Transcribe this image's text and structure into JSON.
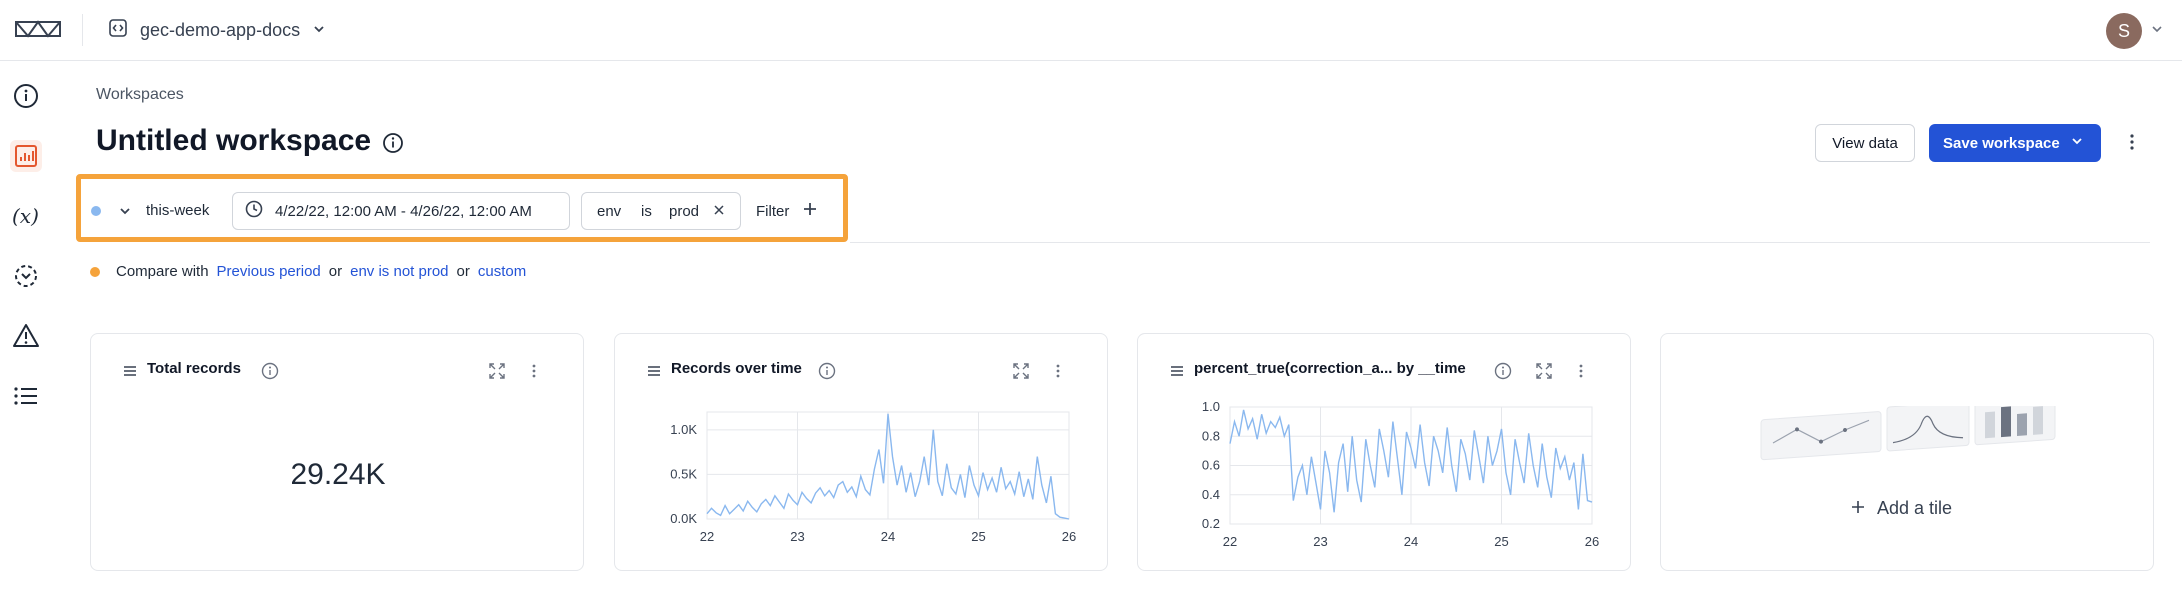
{
  "header": {
    "project_name": "gec-demo-app-docs",
    "avatar_initial": "S"
  },
  "page": {
    "breadcrumb": "Workspaces",
    "title": "Untitled workspace",
    "view_data_label": "View data",
    "save_label": "Save workspace"
  },
  "filters": {
    "segment_name": "this-week",
    "date_range": "4/22/22, 12:00 AM - 4/26/22, 12:00 AM",
    "condition": {
      "field": "env",
      "operator": "is",
      "value": "prod"
    },
    "filter_label": "Filter"
  },
  "compare": {
    "prefix": "Compare with",
    "option_previous": "Previous period",
    "sep1": "or",
    "option_env": "env is not prod",
    "sep2": "or",
    "option_custom": "custom"
  },
  "tiles": {
    "total": {
      "title": "Total records",
      "value": "29.24K"
    },
    "records_over_time": {
      "title": "Records over time"
    },
    "percent_true": {
      "title": "percent_true(correction_a... by __time"
    },
    "add_tile_label": "Add a tile"
  },
  "chart_data": [
    {
      "type": "line",
      "title": "Records over time",
      "x_tick_labels": [
        "22",
        "23",
        "24",
        "25",
        "26"
      ],
      "y_tick_labels": [
        "0.0K",
        "0.5K",
        "1.0K"
      ],
      "xlim": [
        22,
        26
      ],
      "ylim": [
        0,
        1200
      ],
      "x": [
        22.0,
        22.05,
        22.1,
        22.15,
        22.2,
        22.25,
        22.3,
        22.35,
        22.4,
        22.45,
        22.5,
        22.55,
        22.6,
        22.65,
        22.7,
        22.75,
        22.8,
        22.85,
        22.9,
        22.95,
        23.0,
        23.05,
        23.1,
        23.15,
        23.2,
        23.25,
        23.3,
        23.35,
        23.4,
        23.45,
        23.5,
        23.55,
        23.6,
        23.65,
        23.7,
        23.75,
        23.8,
        23.85,
        23.9,
        23.95,
        24.0,
        24.05,
        24.1,
        24.15,
        24.2,
        24.25,
        24.3,
        24.35,
        24.4,
        24.45,
        24.5,
        24.55,
        24.6,
        24.65,
        24.7,
        24.75,
        24.8,
        24.85,
        24.9,
        24.95,
        25.0,
        25.05,
        25.1,
        25.15,
        25.2,
        25.25,
        25.3,
        25.35,
        25.4,
        25.45,
        25.5,
        25.55,
        25.6,
        25.65,
        25.7,
        25.75,
        25.8,
        25.85,
        25.9,
        25.95,
        26.0
      ],
      "series": [
        {
          "values": [
            60,
            120,
            70,
            40,
            150,
            60,
            110,
            160,
            90,
            200,
            130,
            80,
            170,
            220,
            150,
            260,
            190,
            120,
            280,
            210,
            160,
            300,
            230,
            180,
            290,
            350,
            260,
            320,
            240,
            380,
            420,
            300,
            360,
            250,
            480,
            330,
            270,
            560,
            780,
            400,
            1180,
            700,
            380,
            600,
            300,
            520,
            250,
            420,
            700,
            380,
            1000,
            420,
            260,
            620,
            350,
            280,
            500,
            240,
            600,
            380,
            260,
            520,
            330,
            460,
            300,
            580,
            340,
            420,
            280,
            530,
            250,
            450,
            220,
            700,
            380,
            180,
            480,
            60,
            20,
            10,
            0
          ]
        }
      ]
    },
    {
      "type": "line",
      "title": "percent_true(correction_a... by __time",
      "x_tick_labels": [
        "22",
        "23",
        "24",
        "25",
        "26"
      ],
      "y_tick_labels": [
        "0.2",
        "0.4",
        "0.6",
        "0.8",
        "1.0"
      ],
      "xlim": [
        22,
        26
      ],
      "ylim": [
        0.2,
        1.0
      ],
      "x": [
        22.0,
        22.05,
        22.1,
        22.15,
        22.2,
        22.25,
        22.3,
        22.35,
        22.4,
        22.45,
        22.5,
        22.55,
        22.6,
        22.65,
        22.7,
        22.75,
        22.8,
        22.85,
        22.9,
        22.95,
        23.0,
        23.05,
        23.1,
        23.15,
        23.2,
        23.25,
        23.3,
        23.35,
        23.4,
        23.45,
        23.5,
        23.55,
        23.6,
        23.65,
        23.7,
        23.75,
        23.8,
        23.85,
        23.9,
        23.95,
        24.0,
        24.05,
        24.1,
        24.15,
        24.2,
        24.25,
        24.3,
        24.35,
        24.4,
        24.45,
        24.5,
        24.55,
        24.6,
        24.65,
        24.7,
        24.75,
        24.8,
        24.85,
        24.9,
        24.95,
        25.0,
        25.05,
        25.1,
        25.15,
        25.2,
        25.25,
        25.3,
        25.35,
        25.4,
        25.45,
        25.5,
        25.55,
        25.6,
        25.65,
        25.7,
        25.75,
        25.8,
        25.85,
        25.9,
        25.95,
        26.0
      ],
      "series": [
        {
          "values": [
            0.75,
            0.9,
            0.8,
            0.98,
            0.85,
            0.92,
            0.78,
            0.95,
            0.82,
            0.9,
            0.86,
            0.93,
            0.8,
            0.88,
            0.36,
            0.52,
            0.6,
            0.4,
            0.66,
            0.48,
            0.3,
            0.7,
            0.55,
            0.28,
            0.62,
            0.75,
            0.42,
            0.8,
            0.5,
            0.35,
            0.78,
            0.6,
            0.45,
            0.85,
            0.7,
            0.52,
            0.9,
            0.65,
            0.4,
            0.83,
            0.72,
            0.58,
            0.88,
            0.62,
            0.46,
            0.8,
            0.7,
            0.55,
            0.86,
            0.6,
            0.42,
            0.78,
            0.68,
            0.5,
            0.84,
            0.66,
            0.48,
            0.8,
            0.6,
            0.7,
            0.85,
            0.55,
            0.4,
            0.78,
            0.62,
            0.48,
            0.82,
            0.6,
            0.45,
            0.75,
            0.52,
            0.38,
            0.72,
            0.58,
            0.66,
            0.5,
            0.62,
            0.3,
            0.68,
            0.36,
            0.35
          ]
        }
      ]
    }
  ],
  "colors": {
    "accent": "#2353d6",
    "highlight": "#f5a33b",
    "series": "#8ab8ef",
    "active_nav_bg": "#fdeee8",
    "active_nav_icon": "#e4572e"
  }
}
